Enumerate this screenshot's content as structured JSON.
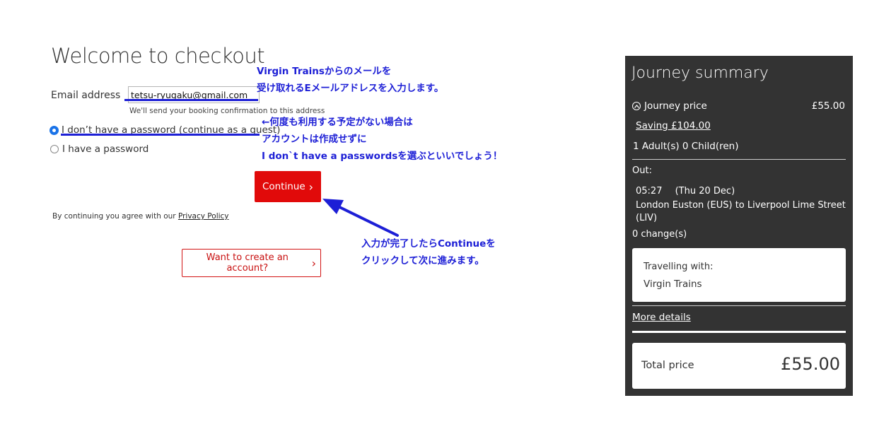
{
  "checkout": {
    "title": "Welcome to checkout",
    "email_label": "Email address",
    "email_value": "tetsu-ryugaku@gmail.com",
    "email_hint": "We'll send your booking confirmation to this address",
    "radio_guest": "I don’t have a password (continue as a guest)",
    "radio_password": "I have a password",
    "continue_label": "Continue",
    "continue_chevron": "›",
    "agree_text": "By continuing you agree with our ",
    "privacy_link": "Privacy Policy",
    "create_account_label": "Want to create an account?",
    "create_chevron": "›"
  },
  "annotations": {
    "note1_line1": "Virgin Trainsからのメールを",
    "note1_line2": "受け取れるEメールアドレスを入力します。",
    "note2_line1": "←何度も利用する予定がない場合は",
    "note2_line2": "アカウントは作成せずに",
    "note2_line3": "I don`t have a passwordsを選ぶといいでしょう！",
    "note3_line1": "入力が完了したらContinueを",
    "note3_line2": "クリックして次に進みます。",
    "color": "#1d1fd6"
  },
  "summary": {
    "title": "Journey summary",
    "price_label": "Journey price",
    "price_value": "£55.00",
    "saving": "Saving £104.00",
    "passengers": "1 Adult(s) 0 Child(ren)",
    "out_label": "Out:",
    "out_time": "05:27",
    "out_date": "(Thu 20 Dec)",
    "route": "London Euston (EUS) to Liverpool Lime Street (LIV)",
    "changes": "0 change(s)",
    "travelling_with_label": "Travelling with:",
    "operator": "Virgin Trains",
    "more_details": "More details",
    "total_label": "Total price",
    "total_value": "£55.00"
  },
  "colors": {
    "brand_red": "#e10a0a",
    "panel_bg": "#333333",
    "radio_blue": "#1a73e8"
  }
}
